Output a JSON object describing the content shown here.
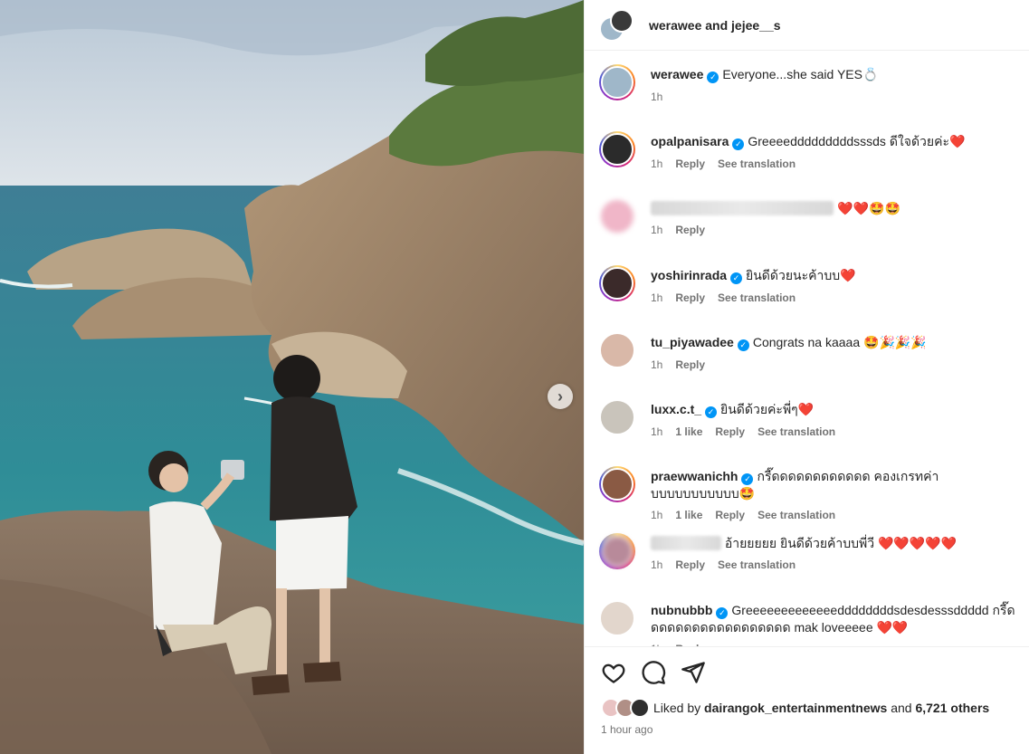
{
  "header": {
    "user1": "werawee",
    "and_text": "and",
    "user2": "jejee__s"
  },
  "caption": {
    "username": "werawee",
    "text": "Everyone...she said YES💍",
    "time": "1h"
  },
  "comments": [
    {
      "username": "opalpanisara",
      "verified": true,
      "text": "Greeeedddddddddsssds ดีใจด้วยค่ะ❤️",
      "time": "1h",
      "likes": "",
      "reply": "Reply",
      "translation": "See translation",
      "ring": true,
      "blurred": false,
      "avatar_color": "#2b2b2b"
    },
    {
      "username": "dairangok_entertainmentnews",
      "verified": false,
      "text": "❤️❤️🤩🤩",
      "time": "1h",
      "likes": "",
      "reply": "Reply",
      "translation": "",
      "ring": false,
      "blurred": true,
      "avatar_color": "#f0b6c8"
    },
    {
      "username": "yoshirinrada",
      "verified": true,
      "text": "ยินดีด้วยนะค้าบบ❤️",
      "time": "1h",
      "likes": "",
      "reply": "Reply",
      "translation": "See translation",
      "ring": true,
      "blurred": false,
      "avatar_color": "#3b2a2a"
    },
    {
      "username": "tu_piyawadee",
      "verified": true,
      "text": "Congrats na kaaaa 🤩🎉🎉🎉",
      "time": "1h",
      "likes": "",
      "reply": "Reply",
      "translation": "",
      "ring": false,
      "blurred": false,
      "avatar_color": "#d9b8a8"
    },
    {
      "username": "luxx.c.t_",
      "verified": true,
      "text": "ยินดีด้วยค่ะพี่ๆ❤️",
      "time": "1h",
      "likes": "1 like",
      "reply": "Reply",
      "translation": "See translation",
      "ring": false,
      "blurred": false,
      "avatar_color": "#c9c4bb"
    },
    {
      "username": "praewwanichh",
      "verified": true,
      "text": "กรี๊ดดดดดดดดดดดด คองเกรทค่าบบบบบบบบบบบ🤩",
      "time": "1h",
      "likes": "1 like",
      "reply": "Reply",
      "translation": "See translation",
      "ring": true,
      "blurred": false,
      "avatar_color": "#8a5a44"
    },
    {
      "username": "jejee_friend",
      "verified": false,
      "text": "อ้ายยยยย ยินดีด้วยค้าบบพี่วี ❤️❤️❤️❤️❤️",
      "time": "1h",
      "likes": "",
      "reply": "Reply",
      "translation": "See translation",
      "ring": true,
      "blurred": true,
      "avatar_color": "#b88a9a"
    },
    {
      "username": "nubnubbb",
      "verified": true,
      "text": "Greeeeeeeeeeeeeddddddddsdesdesssddddd กรี๊ดดดดดดดดดดดดดดดดดด mak loveeeee ❤️❤️",
      "time": "1h",
      "likes": "",
      "reply": "Reply",
      "translation": "",
      "ring": false,
      "blurred": false,
      "avatar_color": "#e2d6cc"
    }
  ],
  "actions": {
    "liked_prefix": "Liked by",
    "liked_user": "dairangok_entertainmentnews",
    "liked_and": "and",
    "liked_others": "6,721 others",
    "time": "1 hour ago"
  },
  "icons": [
    "heart-icon",
    "comment-icon",
    "share-icon",
    "next-icon",
    "verified-icon"
  ],
  "colors": {
    "verified": "#0095f6",
    "muted": "#737373",
    "text": "#262626"
  }
}
